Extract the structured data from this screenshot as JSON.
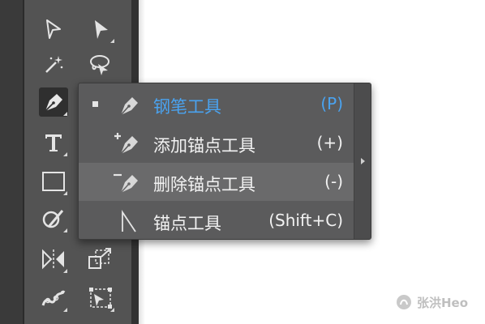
{
  "toolbar": {
    "tools": [
      {
        "name": "direct-selection-tool"
      },
      {
        "name": "selection-tool"
      },
      {
        "name": "magic-wand-tool"
      },
      {
        "name": "lasso-tool"
      },
      {
        "name": "pen-tool"
      },
      {
        "name": "type-tool"
      },
      {
        "name": "rectangle-tool"
      },
      {
        "name": "shaper-tool"
      },
      {
        "name": "reflect-tool"
      },
      {
        "name": "scale-tool"
      },
      {
        "name": "puppet-warp-tool"
      },
      {
        "name": "free-transform-tool"
      }
    ]
  },
  "flyout": {
    "items": [
      {
        "label": "钢笔工具",
        "shortcut": "(P)",
        "icon": "pen-icon",
        "selected": true
      },
      {
        "label": "添加锚点工具",
        "shortcut": "(+)",
        "icon": "add-anchor-point-icon"
      },
      {
        "label": "删除锚点工具",
        "shortcut": "(-)",
        "icon": "delete-anchor-point-icon",
        "hovered": true
      },
      {
        "label": "锚点工具",
        "shortcut": "(Shift+C)",
        "icon": "anchor-point-icon"
      }
    ],
    "accent_color": "#4aa3f0"
  },
  "watermark": {
    "text": "张洪Heo"
  }
}
